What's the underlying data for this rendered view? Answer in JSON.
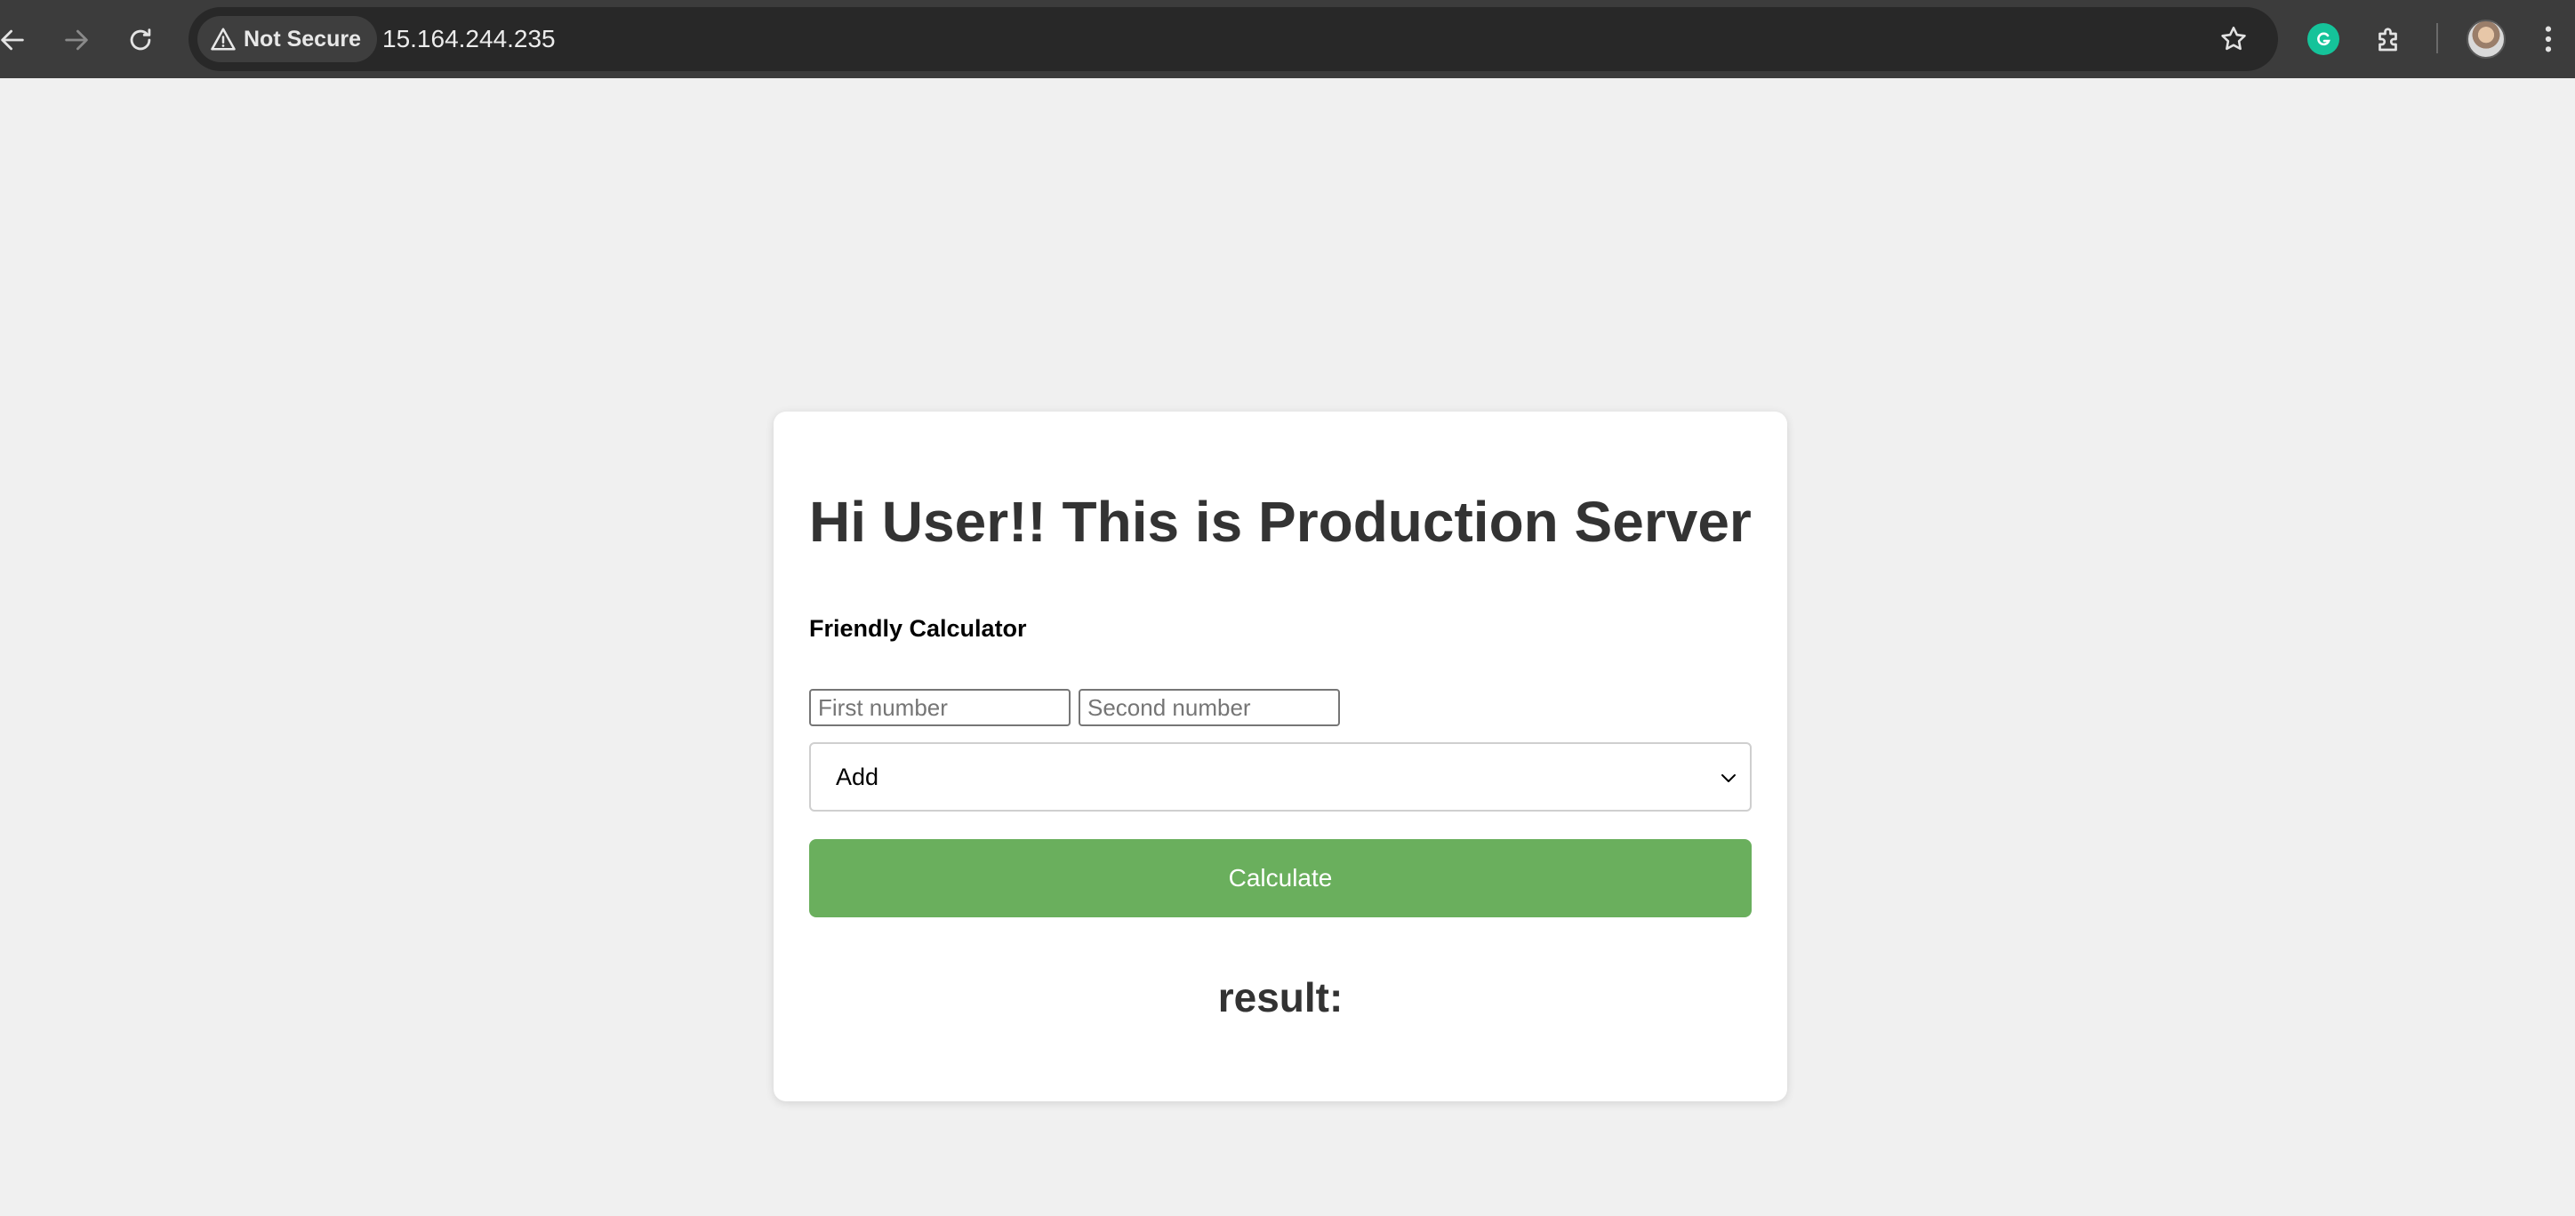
{
  "browser": {
    "security_label": "Not Secure",
    "url": "15.164.244.235",
    "icons": {
      "back": "arrow-left-icon",
      "forward": "arrow-right-icon",
      "reload": "reload-icon",
      "warning": "warning-triangle-icon",
      "bookmark": "star-icon",
      "grammarly": "grammarly-icon",
      "extensions": "puzzle-icon",
      "menu": "kebab-menu-icon"
    },
    "colors": {
      "toolbar": "#3c3c3c",
      "omnibox": "#282828"
    }
  },
  "page": {
    "heading": "Hi User!! This is Production Server",
    "subtitle": "Friendly Calculator",
    "first_input": {
      "placeholder": "First number",
      "value": ""
    },
    "second_input": {
      "placeholder": "Second number",
      "value": ""
    },
    "operation": {
      "selected": "Add"
    },
    "calculate_label": "Calculate",
    "result_label": "result:",
    "colors": {
      "background": "#f0f0f0",
      "card": "#ffffff",
      "button": "#6aaf5d",
      "heading": "#333333"
    }
  }
}
